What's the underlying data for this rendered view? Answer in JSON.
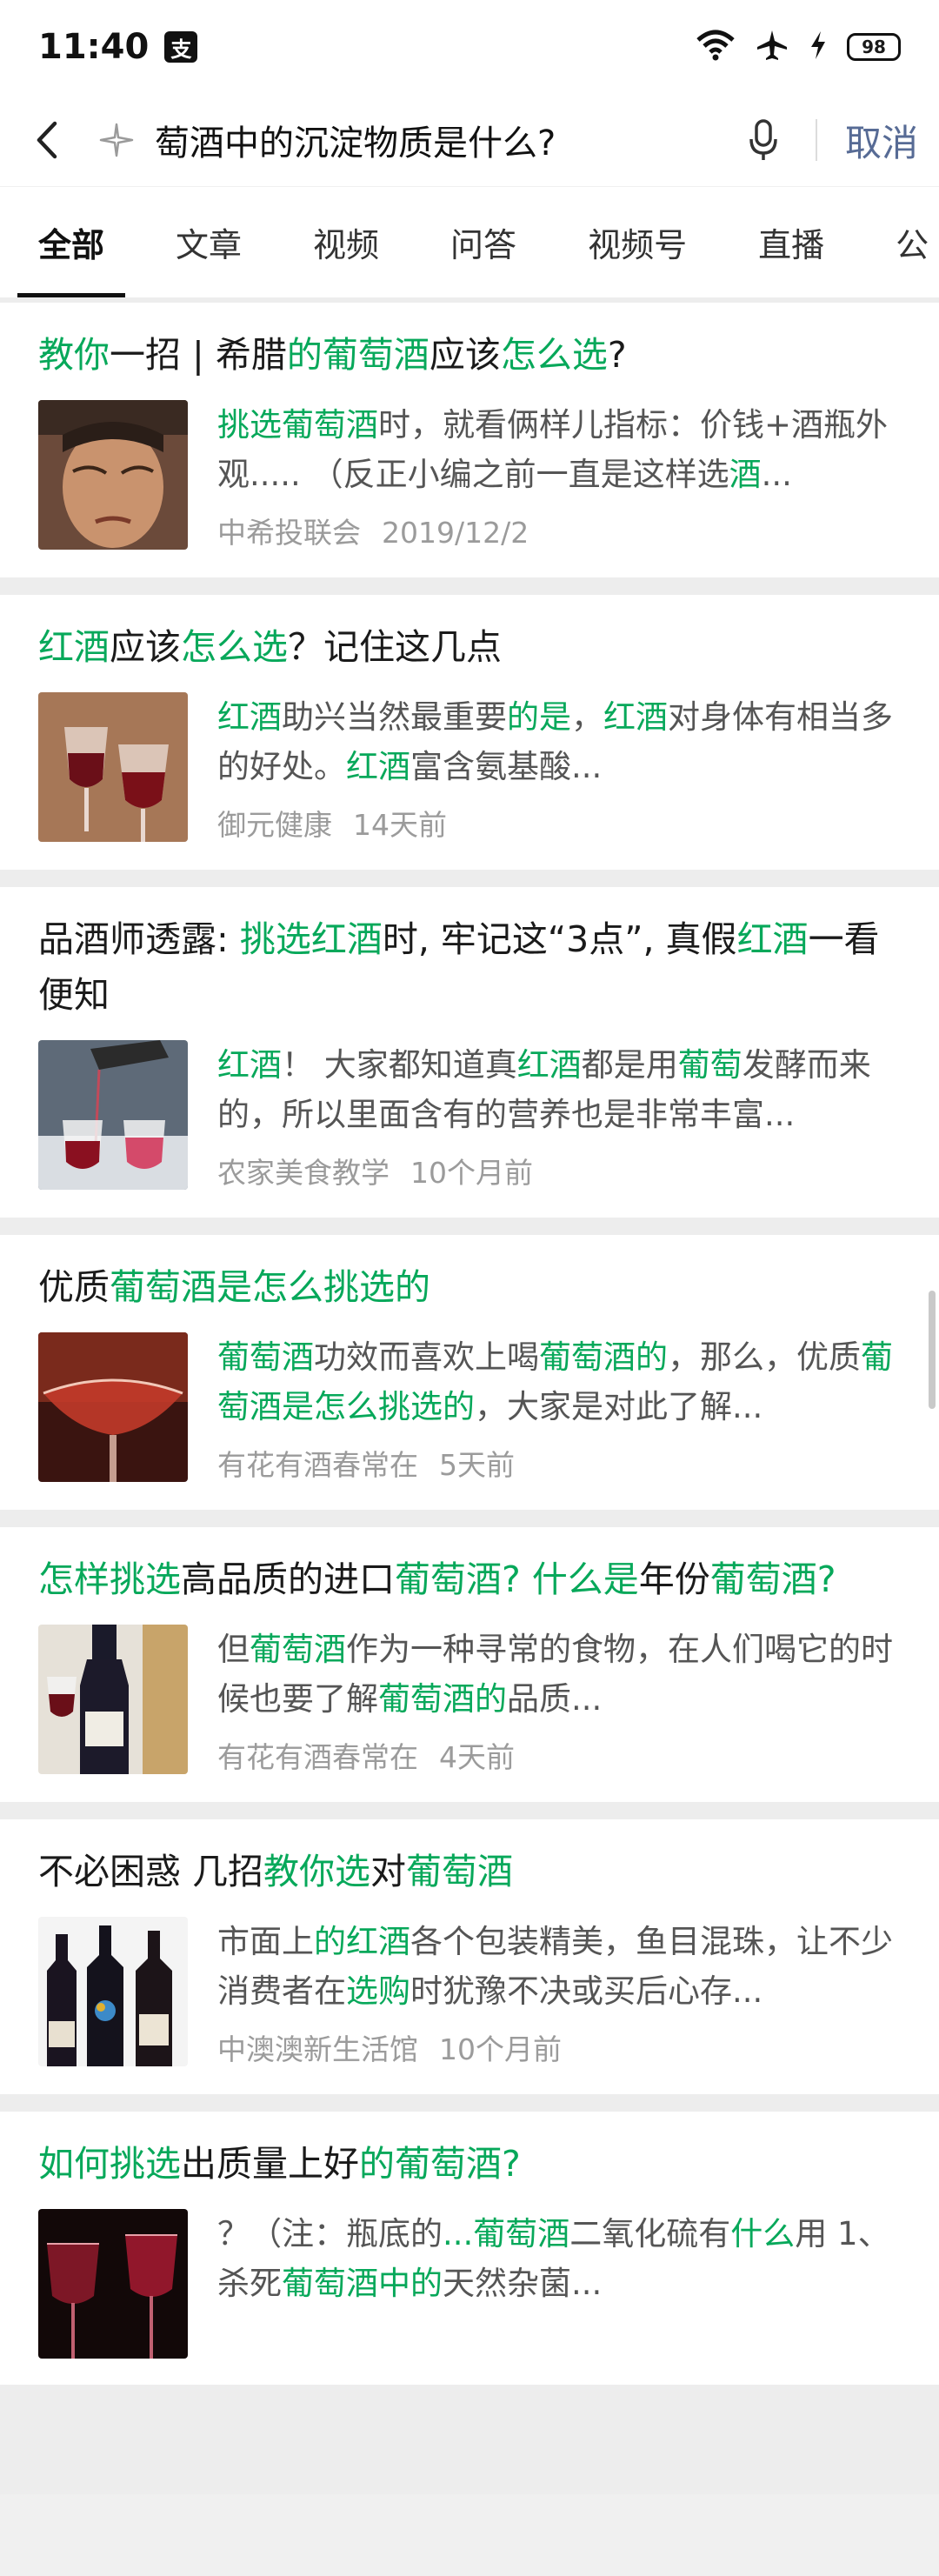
{
  "status": {
    "time": "11:40",
    "app_badge": "支",
    "battery": "98"
  },
  "search": {
    "query": "萄酒中的沉淀物质是什么?",
    "cancel": "取消"
  },
  "tabs": [
    "全部",
    "文章",
    "视频",
    "问答",
    "视频号",
    "直播",
    "公"
  ],
  "results": [
    {
      "title": [
        [
          "教你",
          "g"
        ],
        [
          "一招 | 希腊",
          ""
        ],
        [
          "的葡萄酒",
          "g"
        ],
        [
          "应该",
          ""
        ],
        [
          "怎么选",
          "g"
        ],
        [
          "?",
          ""
        ]
      ],
      "snippet": [
        [
          "挑选葡萄酒",
          "g"
        ],
        [
          "时，就看俩样儿指标：价钱+酒瓶外观..... （反正小编之前一直是这样选",
          ""
        ],
        [
          "酒",
          "g"
        ],
        [
          "...",
          ""
        ]
      ],
      "source": "中希投联会",
      "date": "2019/12/2",
      "thumb": "portrait"
    },
    {
      "title": [
        [
          "红酒",
          "g"
        ],
        [
          "应该",
          ""
        ],
        [
          "怎么选",
          "g"
        ],
        [
          "？记住这几点",
          ""
        ]
      ],
      "snippet": [
        [
          "红酒",
          "g"
        ],
        [
          "助兴当然最重要",
          ""
        ],
        [
          "的是",
          "g"
        ],
        [
          "，",
          ""
        ],
        [
          "红酒",
          "g"
        ],
        [
          "对身体有相当多的好处。",
          ""
        ],
        [
          "红酒",
          "g"
        ],
        [
          "富含氨基酸...",
          ""
        ]
      ],
      "source": "御元健康",
      "date": "14天前",
      "thumb": "glasses-toast"
    },
    {
      "title": [
        [
          "品酒师透露: ",
          ""
        ],
        [
          "挑选红酒",
          "g"
        ],
        [
          "时, 牢记这“3点”, 真假",
          ""
        ],
        [
          "红酒",
          "g"
        ],
        [
          "一看便知",
          ""
        ]
      ],
      "snippet": [
        [
          "红酒",
          "g"
        ],
        [
          "！ 大家都知道真",
          ""
        ],
        [
          "红酒",
          "g"
        ],
        [
          "都是用",
          ""
        ],
        [
          "葡萄",
          "g"
        ],
        [
          "发酵而来的，所以里面含有的营养也是非常丰富...",
          ""
        ]
      ],
      "source": "农家美食教学",
      "date": "10个月前",
      "thumb": "pour"
    },
    {
      "title": [
        [
          "优质",
          ""
        ],
        [
          "葡萄酒是怎么挑选的",
          "g"
        ]
      ],
      "snippet": [
        [
          "葡萄酒",
          "g"
        ],
        [
          "功效而喜欢上喝",
          ""
        ],
        [
          "葡萄酒的",
          "g"
        ],
        [
          "，那么，优质",
          ""
        ],
        [
          "葡萄酒是怎么挑选的",
          "g"
        ],
        [
          "，大家是对此了解...",
          ""
        ]
      ],
      "source": "有花有酒春常在",
      "date": "5天前",
      "thumb": "coupe"
    },
    {
      "title": [
        [
          "怎样挑选",
          "g"
        ],
        [
          "高品质的进口",
          ""
        ],
        [
          "葡萄酒? 什么是",
          "g"
        ],
        [
          "年份",
          ""
        ],
        [
          "葡萄酒?",
          "g"
        ]
      ],
      "snippet": [
        [
          "但",
          ""
        ],
        [
          "葡萄酒",
          "g"
        ],
        [
          "作为一种寻常的食物，在人们喝它的时候也要了解",
          ""
        ],
        [
          "葡萄酒的",
          "g"
        ],
        [
          "品质...",
          ""
        ]
      ],
      "source": "有花有酒春常在",
      "date": "4天前",
      "thumb": "bottle"
    },
    {
      "title": [
        [
          "不必困惑 几招",
          ""
        ],
        [
          "教你选",
          "g"
        ],
        [
          "对",
          ""
        ],
        [
          "葡萄酒",
          "g"
        ]
      ],
      "snippet": [
        [
          "市面上",
          ""
        ],
        [
          "的红酒",
          "g"
        ],
        [
          "各个包装精美，鱼目混珠，让不少消费者在",
          ""
        ],
        [
          "选购",
          "g"
        ],
        [
          "时犹豫不决或买后心存...",
          ""
        ]
      ],
      "source": "中澳澳新生活馆",
      "date": "10个月前",
      "thumb": "bottles"
    },
    {
      "title": [
        [
          "如何挑选",
          "g"
        ],
        [
          "出质量上好",
          ""
        ],
        [
          "的葡萄酒?",
          "g"
        ]
      ],
      "snippet": [
        [
          "？（注：瓶底的",
          ""
        ],
        [
          "...葡萄酒",
          "g"
        ],
        [
          "二氧化硫有",
          ""
        ],
        [
          "什么",
          "g"
        ],
        [
          "用 1、杀死",
          ""
        ],
        [
          "葡萄酒中的",
          "g"
        ],
        [
          "天然杂菌...",
          ""
        ]
      ],
      "source": "",
      "date": "",
      "thumb": "dark-glasses"
    }
  ]
}
